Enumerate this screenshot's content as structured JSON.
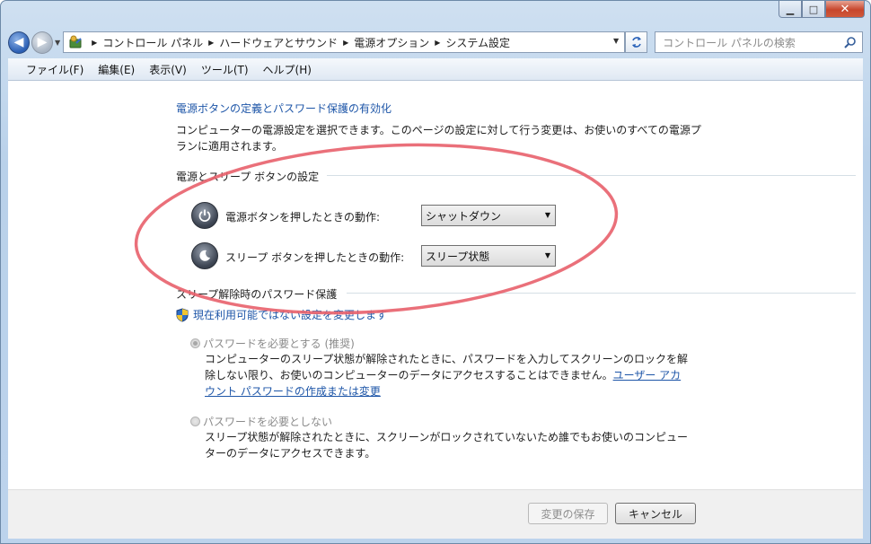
{
  "window": {
    "caption_buttons": {
      "minimize": "▁",
      "maximize": "□",
      "close": "✕"
    }
  },
  "nav": {
    "breadcrumbs": [
      "コントロール パネル",
      "ハードウェアとサウンド",
      "電源オプション",
      "システム設定"
    ],
    "search_placeholder": "コントロール パネルの検索"
  },
  "menu": [
    "ファイル(F)",
    "編集(E)",
    "表示(V)",
    "ツール(T)",
    "ヘルプ(H)"
  ],
  "main": {
    "title_link": "電源ボタンの定義とパスワード保護の有効化",
    "description": "コンピューターの電源設定を選択できます。このページの設定に対して行う変更は、お使いのすべての電源プランに適用されます。",
    "power_group": {
      "header": "電源とスリープ ボタンの設定",
      "rows": [
        {
          "label": "電源ボタンを押したときの動作:",
          "value": "シャットダウン",
          "icon": "power-icon"
        },
        {
          "label": "スリープ ボタンを押したときの動作:",
          "value": "スリープ状態",
          "icon": "sleep-icon"
        }
      ]
    },
    "password_group": {
      "header": "スリープ解除時のパスワード保護",
      "change_link": "現在利用可能ではない設定を変更します",
      "options": [
        {
          "label": "パスワードを必要とする (推奨)",
          "checked": true,
          "description": "コンピューターのスリープ状態が解除されたときに、パスワードを入力してスクリーンのロックを解除しない限り、お使いのコンピューターのデータにアクセスすることはできません。",
          "link": "ユーザー アカウント パスワードの作成または変更"
        },
        {
          "label": "パスワードを必要としない",
          "checked": false,
          "description": "スリープ状態が解除されたときに、スクリーンがロックされていないため誰でもお使いのコンピューターのデータにアクセスできます。"
        }
      ]
    }
  },
  "footer": {
    "save_label": "変更の保存",
    "cancel_label": "キャンセル"
  },
  "colors": {
    "link": "#1e56a8",
    "annotation": "#e8606b",
    "window_frame": "#bcd3ec"
  }
}
